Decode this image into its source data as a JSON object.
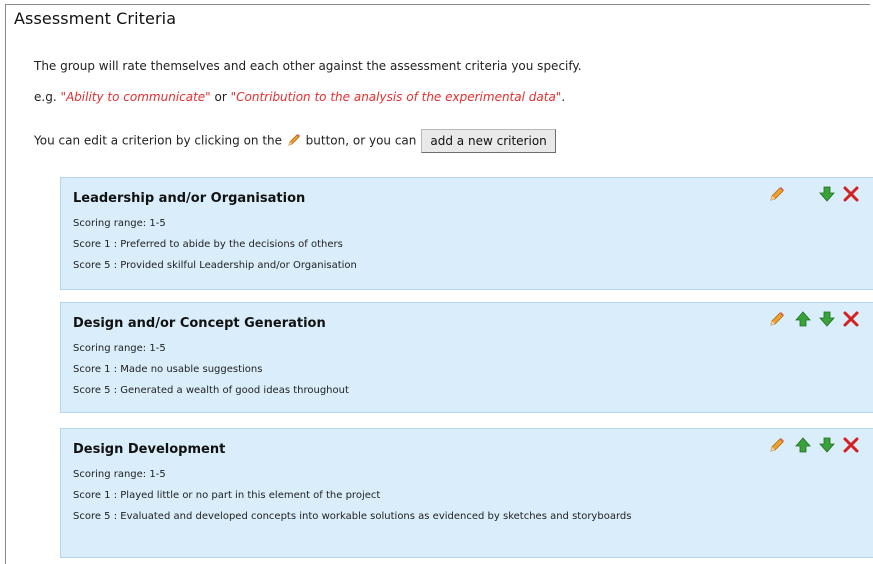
{
  "page": {
    "title": "Assessment Criteria",
    "intro": "The group will rate themselves and each other against the assessment criteria you specify.",
    "example_prefix": "e.g. ",
    "example_1": "\"Ability to communicate\"",
    "example_or": " or ",
    "example_2": "\"Contribution to the analysis of the experimental data\"",
    "example_suffix": ".",
    "edit_text_before": "You can edit a criterion by clicking on the ",
    "edit_text_after": " button, or you can",
    "add_button_label": "add a new criterion"
  },
  "criteria": [
    {
      "title": "Leadership and/or Organisation",
      "range": "Scoring range: 1-5",
      "score1": "Score 1 : Preferred to abide by the decisions of others",
      "score5": "Score 5 : Provided skilful Leadership and/or Organisation"
    },
    {
      "title": "Design and/or Concept Generation",
      "range": "Scoring range: 1-5",
      "score1": "Score 1 : Made no usable suggestions",
      "score5": "Score 5 : Generated a wealth of good ideas throughout"
    },
    {
      "title": "Design Development",
      "range": "Scoring range: 1-5",
      "score1": "Score 1 : Played little or no part in this element of the project",
      "score5": "Score 5 : Evaluated and developed concepts into workable solutions as evidenced by sketches and storyboards"
    }
  ],
  "icons": {
    "edit": "pencil-icon",
    "move_up": "arrow-up-icon",
    "move_down": "arrow-down-icon",
    "delete": "delete-x-icon"
  },
  "colors": {
    "example_text": "#e23030",
    "card_background": "#d9edfa",
    "card_border": "#b6d6ee",
    "arrow_green": "#3aa23a",
    "delete_red": "#d42020"
  }
}
